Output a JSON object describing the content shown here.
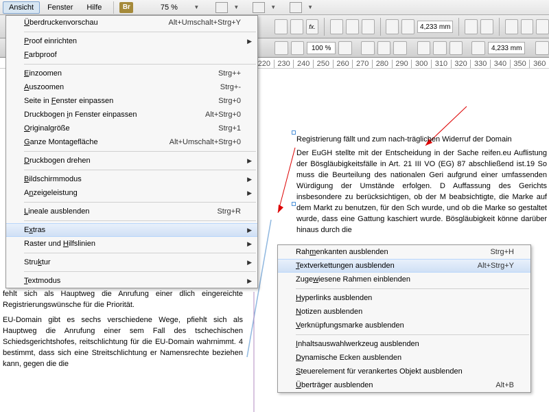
{
  "menubar": {
    "items": [
      "Ansicht",
      "Fenster",
      "Hilfe"
    ],
    "br": "Br",
    "zoom": "75 %"
  },
  "toolbar": {
    "pct": "100 %",
    "mm1": "4,233 mm",
    "mm2": "4,233 mm"
  },
  "ruler": [
    "220",
    "230",
    "240",
    "250",
    "260",
    "270",
    "280",
    "290",
    "300",
    "310",
    "320",
    "330",
    "340",
    "350",
    "360"
  ],
  "doc": {
    "right_p1": "Registrierung fällt und zum nach-träglichen Widerruf der Domain",
    "right_p2": "Der EuGH stellte mit der Entscheidung in der Sache reifen.eu Auflistung der Bösgläubigkeitsfälle in Art. 21 III VO (EG) 87 abschließend ist.19 So muss die Beurteilung des nationalen Geri aufgrund einer umfassenden Würdigung der Umstände erfolgen. D Auffassung des Gerichts insbesondere zu berücksichtigen, ob der M beabsichtigte, die Marke auf dem Markt zu benutzen, für den Sch wurde, und ob die Marke so gestaltet wurde, dass eine Gattung kaschiert wurde. Bösgläubigkeit könne darüber hinaus durch die",
    "left_p1": "fehlt sich als Hauptweg die Anrufung einer dlich eingereichte Registrierungswünsche für die Priorität.",
    "left_p2": "EU-Domain gibt es sechs verschiedene Wege, pfiehlt sich als Hauptweg die Anrufung einer sem Fall des tschechischen Schiedsgerichtshofes, reitschlichtung für die EU-Domain wahrnimmt. 4 bestimmt, dass sich eine Streitschlichtung er Namensrechte beziehen kann, gegen die die"
  },
  "menu": {
    "items": [
      {
        "label": "Überdruckenvorschau",
        "u": "Ü",
        "shortcut": "Alt+Umschalt+Strg+Y"
      },
      {
        "sep": true
      },
      {
        "label": "Proof einrichten",
        "u": "P",
        "arrow": true
      },
      {
        "label": "Farbproof",
        "u": "F"
      },
      {
        "sep": true
      },
      {
        "label": "Einzoomen",
        "u": "E",
        "shortcut": "Strg++"
      },
      {
        "label": "Auszoomen",
        "u": "A",
        "shortcut": "Strg+-"
      },
      {
        "label": "Seite in Fenster einpassen",
        "u": "F",
        "shortcut": "Strg+0"
      },
      {
        "label": "Druckbogen in Fenster einpassen",
        "u": "i",
        "shortcut": "Alt+Strg+0"
      },
      {
        "label": "Originalgröße",
        "u": "O",
        "shortcut": "Strg+1"
      },
      {
        "label": "Ganze Montagefläche",
        "u": "G",
        "shortcut": "Alt+Umschalt+Strg+0"
      },
      {
        "sep": true
      },
      {
        "label": "Druckbogen drehen",
        "u": "D",
        "arrow": true
      },
      {
        "sep": true
      },
      {
        "label": "Bildschirmmodus",
        "u": "B",
        "arrow": true
      },
      {
        "label": "Anzeigeleistung",
        "u": "n",
        "arrow": true
      },
      {
        "sep": true
      },
      {
        "label": "Lineale ausblenden",
        "u": "L",
        "shortcut": "Strg+R"
      },
      {
        "sep": true
      },
      {
        "label": "Extras",
        "u": "x",
        "arrow": true,
        "hover": true
      },
      {
        "label": "Raster und Hilfslinien",
        "u": "H",
        "arrow": true
      },
      {
        "sep": true
      },
      {
        "label": "Struktur",
        "u": "k",
        "arrow": true
      },
      {
        "sep": true
      },
      {
        "label": "Textmodus",
        "u": "T",
        "arrow": true
      }
    ]
  },
  "submenu": {
    "items": [
      {
        "label": "Rahmenkanten ausblenden",
        "u": "m",
        "shortcut": "Strg+H"
      },
      {
        "label": "Textverkettungen ausblenden",
        "u": "T",
        "shortcut": "Alt+Strg+Y",
        "hover": true
      },
      {
        "label": "Zugewiesene Rahmen einblenden",
        "u": "w"
      },
      {
        "sep": true
      },
      {
        "label": "Hyperlinks ausblenden",
        "u": "H"
      },
      {
        "label": "Notizen ausblenden",
        "u": "N"
      },
      {
        "label": "Verknüpfungsmarke ausblenden",
        "u": "V"
      },
      {
        "sep": true
      },
      {
        "label": "Inhaltsauswahlwerkzeug ausblenden",
        "u": "I"
      },
      {
        "label": "Dynamische Ecken ausblenden",
        "u": "D"
      },
      {
        "label": "Steuerelement für verankertes Objekt ausblenden",
        "u": "S"
      },
      {
        "label": "Überträger ausblenden",
        "u": "Ü",
        "shortcut": "Alt+B"
      }
    ]
  }
}
